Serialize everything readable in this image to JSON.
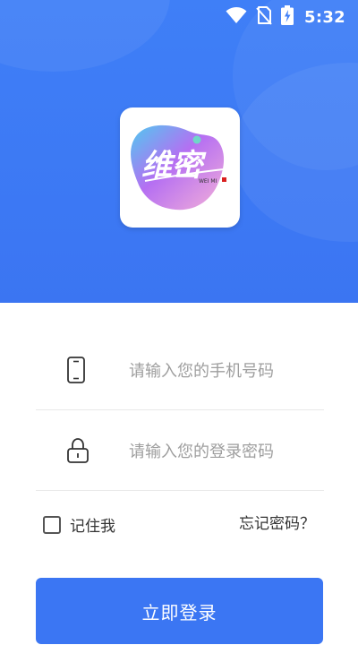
{
  "status_bar": {
    "time": "5:32",
    "icons": [
      "wifi-icon",
      "no-sim-icon",
      "battery-charging-icon"
    ]
  },
  "logo": {
    "brand_text": "维密",
    "brand_subtext": "WEI MI"
  },
  "login_form": {
    "phone_placeholder": "请输入您的手机号码",
    "phone_value": "",
    "password_placeholder": "请输入您的登录密码",
    "password_value": "",
    "phone_icon": "phone-icon",
    "lock_icon": "lock-icon"
  },
  "options": {
    "remember_label": "记住我",
    "remember_checked": false,
    "forgot_label": "忘记密码？"
  },
  "submit_label": "立即登录",
  "colors": {
    "header_blue": "#3f7ff7",
    "button_blue": "#3b76f3",
    "placeholder_gray": "#9e9e9e"
  }
}
